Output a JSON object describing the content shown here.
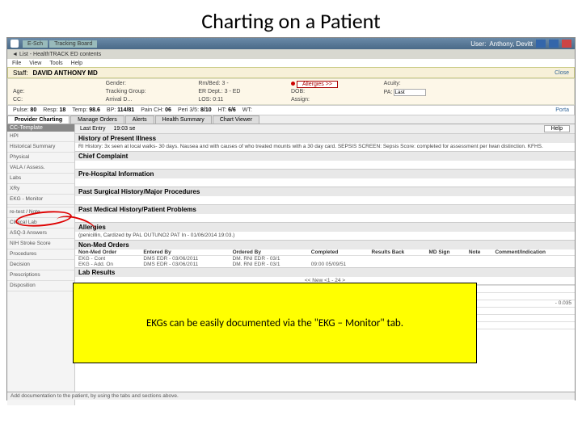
{
  "slide": {
    "title": "Charting on a Patient"
  },
  "titlebar": {
    "tab1": "E-Sch",
    "tab2": "Tracking Board",
    "user_label": "User:",
    "user": "Anthony, Devitt"
  },
  "toolbar2": {
    "back": "◄",
    "item": "List - HealthTRACK ED contents"
  },
  "menu": {
    "file": "File",
    "view": "View",
    "tools": "Tools",
    "help": "Help"
  },
  "staff": {
    "label": "Staff:",
    "name": "DAVID ANTHONY MD",
    "close": "Close"
  },
  "banner": {
    "name_label": "",
    "name": "",
    "gender_label": "Gender:",
    "gender": "",
    "rmbed_label": "Rm/Bed:",
    "rmbed": "3 -",
    "allergies_btn": "Allergies >>",
    "acuity_label": "Acuity:",
    "acuity": "",
    "age_label": "Age:",
    "age": "",
    "tracking_label": "Tracking Group:",
    "tracking": "",
    "erdept_label": "ER Dept.:",
    "erdept": "3 - ED",
    "dob_label": "DOB:",
    "dob": "",
    "cc_label": "CC:",
    "cc": "",
    "arrival_label": "Arrival D...",
    "los_label": "LOS:",
    "los": "0:11",
    "assign_label": "Assign:",
    "assign": "",
    "pa_label": "PA:",
    "pa_value": "Last"
  },
  "vitals": {
    "pulse_l": "Pulse:",
    "pulse": "80",
    "resp_l": "Resp:",
    "resp": "18",
    "temp_l": "Temp:",
    "temp": "98.6",
    "bp_l": "BP:",
    "bp": "114/81",
    "pain_l": "Pain CH:",
    "pain": "06",
    "peri_l": "Peri 3/5:",
    "peri": "8/10",
    "ht_l": "HT:",
    "ht": "6/6",
    "wt_l": "WT:",
    "porta": "Porta"
  },
  "tabs": {
    "t1": "Provider Charting",
    "t2": "Manage Orders",
    "t3": "Alerts",
    "t4": "Health Summary",
    "t5": "Chart Viewer"
  },
  "left": {
    "hdr1": "CC-Template",
    "hdr2": "",
    "items": [
      "HPI",
      "Historical Summary",
      "Physical",
      "VALA / Assess.",
      "Labs",
      "XRy",
      "EKG - Monitor",
      "",
      "re-test / Note",
      "Clinical Lab",
      "ASQ-3 Answers",
      "NIH Stroke Score",
      "Procedures",
      "Decision",
      "Prescriptions",
      "Disposition"
    ]
  },
  "main": {
    "tool": {
      "last": "Last Entry",
      "time": "19:03 se",
      "help": "Help"
    },
    "sections": {
      "hpi": "History of Present Illness",
      "hpi_body": "RI History: 3x seen at local walks- 30 days. Nausea and with causes of who treated mounts with a 30 day card. SEPSIS SCREEN: Sepsis Score: completed for assessment per Iwan distinction. KFHS.",
      "cc": "Chief Complaint",
      "prehospital": "Pre-Hospital Information",
      "surgical": "Past Surgical History/Major Procedures",
      "medhx": "Past Medical History/Patient Problems",
      "allergies": "Allergies",
      "allergies_body": "(penicillin, Cardized by PAL OUTUNO2 PAT In - 01/06/2014 19:03.)",
      "nonmed": "Non-Med Orders",
      "orders_cols": {
        "c1": "Non-Med Order",
        "c2": "Entered By",
        "c3": "Ordered By",
        "c4": "Completed",
        "c5": "Results Back",
        "c6": "MD Sign",
        "c7": "Note",
        "c8": "Comment/Indication"
      },
      "orders_rows": [
        {
          "c1": "EKG - Cont",
          "c2": "DMS EDR - 03/06/2011",
          "c3": "DM. RNI EDR - 03/1",
          "c4": "",
          "c5": "",
          "c6": "",
          "c7": "",
          "c8": ""
        },
        {
          "c1": "EKG - Add. On",
          "c2": "DMS EDR - 03/06/2011",
          "c3": "DM. RNI EDR - 03/1",
          "c4": "09:00 05/09/51",
          "c5": "",
          "c6": "",
          "c7": "",
          "c8": ""
        }
      ],
      "lab": "Lab Results",
      "lab_center": "<< New <1 - 24 >",
      "behind_right": "- 0.035"
    }
  },
  "callout": {
    "text": "EKGs can be easily documented via the \"EKG – Monitor\" tab."
  },
  "status": {
    "text": "Add documentation to the patient, by using the tabs and sections above."
  }
}
